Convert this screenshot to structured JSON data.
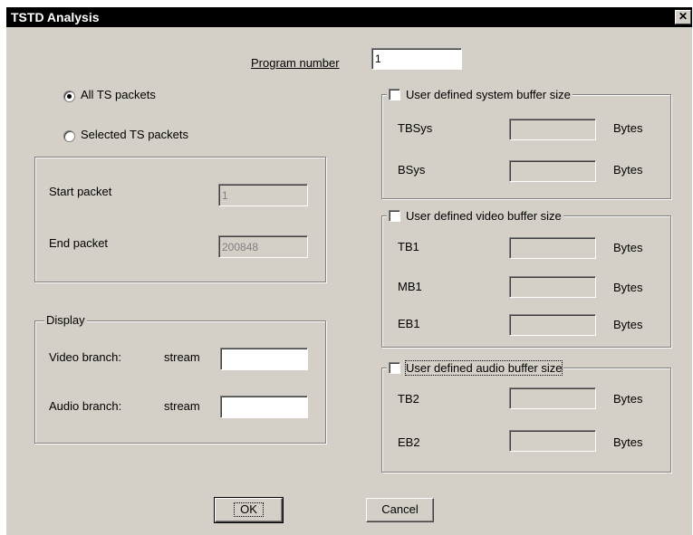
{
  "window": {
    "title": "TSTD Analysis",
    "close_glyph": "✕"
  },
  "program": {
    "label": "Program number",
    "value": "1"
  },
  "packets": {
    "all_label": "All TS packets",
    "selected_label": "Selected TS packets",
    "start_label": "Start packet",
    "start_value": "1",
    "end_label": "End packet",
    "end_value": "200848"
  },
  "display": {
    "legend": "Display",
    "video_label": "Video branch:",
    "audio_label": "Audio branch:",
    "stream_label": "stream",
    "video_stream": "",
    "audio_stream": ""
  },
  "system_buffer": {
    "legend": "User defined system buffer size",
    "rows": [
      {
        "label": "TBSys",
        "value": "",
        "unit": "Bytes"
      },
      {
        "label": "BSys",
        "value": "",
        "unit": "Bytes"
      }
    ]
  },
  "video_buffer": {
    "legend": "User defined video buffer size",
    "rows": [
      {
        "label": "TB1",
        "value": "",
        "unit": "Bytes"
      },
      {
        "label": "MB1",
        "value": "",
        "unit": "Bytes"
      },
      {
        "label": "EB1",
        "value": "",
        "unit": "Bytes"
      }
    ]
  },
  "audio_buffer": {
    "legend": "User defined audio buffer size",
    "rows": [
      {
        "label": "TB2",
        "value": "",
        "unit": "Bytes"
      },
      {
        "label": "EB2",
        "value": "",
        "unit": "Bytes"
      }
    ]
  },
  "buttons": {
    "ok": "OK",
    "cancel": "Cancel"
  }
}
